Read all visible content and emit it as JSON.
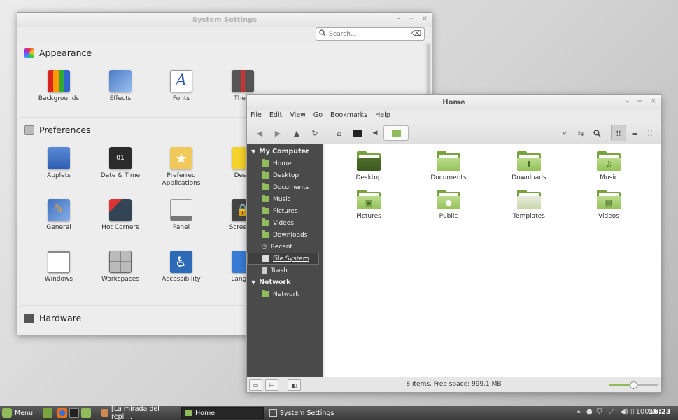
{
  "system_settings": {
    "title": "System Settings",
    "search_placeholder": "Search...",
    "sections": {
      "appearance": {
        "label": "Appearance",
        "items": [
          {
            "label": "Backgrounds"
          },
          {
            "label": "Effects"
          },
          {
            "label": "Fonts"
          },
          {
            "label": "Them"
          }
        ]
      },
      "preferences": {
        "label": "Preferences",
        "items": [
          {
            "label": "Applets"
          },
          {
            "label": "Date & Time"
          },
          {
            "label": "Preferred Applications"
          },
          {
            "label": "Deskl"
          },
          {
            "label": "General"
          },
          {
            "label": "Hot Corners"
          },
          {
            "label": "Panel"
          },
          {
            "label": "Screen L"
          },
          {
            "label": "Windows"
          },
          {
            "label": "Workspaces"
          },
          {
            "label": "Accessibility"
          },
          {
            "label": "Langua"
          }
        ]
      },
      "hardware": {
        "label": "Hardware"
      }
    }
  },
  "nemo": {
    "title": "Home",
    "menu": [
      "File",
      "Edit",
      "View",
      "Go",
      "Bookmarks",
      "Help"
    ],
    "sidebar": {
      "my_computer": "My Computer",
      "places": [
        {
          "label": "Home"
        },
        {
          "label": "Desktop"
        },
        {
          "label": "Documents"
        },
        {
          "label": "Music"
        },
        {
          "label": "Pictures"
        },
        {
          "label": "Videos"
        },
        {
          "label": "Downloads"
        },
        {
          "label": "Recent"
        },
        {
          "label": "File System"
        },
        {
          "label": "Trash"
        }
      ],
      "network_header": "Network",
      "network": [
        {
          "label": "Network"
        }
      ]
    },
    "files": [
      {
        "label": "Desktop",
        "emblem": ""
      },
      {
        "label": "Documents",
        "emblem": ""
      },
      {
        "label": "Downloads",
        "emblem": "⬇"
      },
      {
        "label": "Music",
        "emblem": "♫"
      },
      {
        "label": "Pictures",
        "emblem": "▣"
      },
      {
        "label": "Public",
        "emblem": "●"
      },
      {
        "label": "Templates",
        "emblem": ""
      },
      {
        "label": "Videos",
        "emblem": "▤"
      }
    ],
    "status": "8 items, Free space: 999.1 MB",
    "zoom_fraction": 0.5
  },
  "panel": {
    "menu_label": "Menu",
    "tasks": [
      {
        "label": "[La mirada del repli..."
      },
      {
        "label": "Home"
      },
      {
        "label": "System Settings"
      }
    ],
    "battery": "100%",
    "clock": "16:23"
  },
  "colors": {
    "mint_green": "#8fbb5a",
    "sidebar_bg": "#4a4a4a"
  }
}
